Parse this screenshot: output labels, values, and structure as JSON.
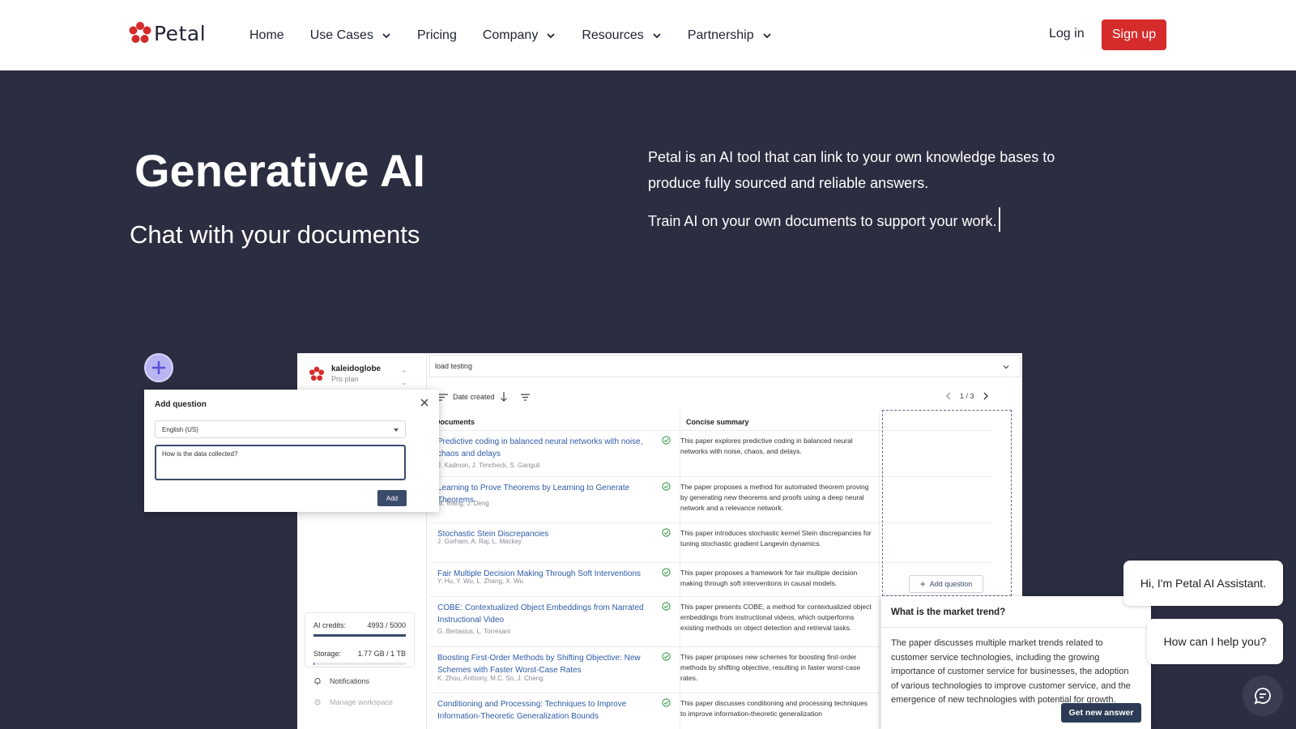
{
  "brand": {
    "name": "Petal",
    "accent": "#d62b2b"
  },
  "nav": {
    "items": [
      {
        "label": "Home",
        "dropdown": false
      },
      {
        "label": "Use Cases",
        "dropdown": true
      },
      {
        "label": "Pricing",
        "dropdown": false
      },
      {
        "label": "Company",
        "dropdown": true
      },
      {
        "label": "Resources",
        "dropdown": true
      },
      {
        "label": "Partnership",
        "dropdown": true
      }
    ],
    "login": "Log in",
    "signup": "Sign up"
  },
  "hero": {
    "title": "Generative AI",
    "subtitle": "Chat with your documents",
    "description": "Petal is an AI tool that can link to your own knowledge bases to produce fully sourced and reliable answers.",
    "description2": "Train AI on your own documents to support your work."
  },
  "app": {
    "workspace": {
      "name": "kaleidoglobe",
      "plan": "Pro plan"
    },
    "search_value": "load testing",
    "sort_label": "Date created",
    "pager": "1 / 3",
    "columns": {
      "documents": "Documents",
      "summary": "Concise summary"
    },
    "rows": [
      {
        "title": "Predictive coding in balanced neural networks with noise, chaos and delays",
        "authors": "J. Kadmon, J. Timcheck, S. Ganguli",
        "summary": "This paper explores predictive coding in balanced neural networks with noise, chaos, and delays."
      },
      {
        "title": "Learning to Prove Theorems by Learning to Generate Theorems",
        "authors": "M. Wang, J. Deng",
        "summary": "The paper proposes a method for automated theorem proving by generating new theorems and proofs using a deep neural network and a relevance network."
      },
      {
        "title": "Stochastic Stein Discrepancies",
        "authors": "J. Gorham, A. Raj, L. Mackey",
        "summary": "This paper introduces stochastic kernel Stein discrepancies for tuning stochastic gradient Langevin dynamics."
      },
      {
        "title": "Fair Multiple Decision Making Through Soft Interventions",
        "authors": "Y. Hu, Y. Wu, L. Zhang, X. Wu",
        "summary": "This paper proposes a framework for fair multiple decision making through soft interventions in causal models."
      },
      {
        "title": "COBE: Contextualized Object Embeddings from Narrated Instructional Video",
        "authors": "G. Bertasius, L. Torresani",
        "summary": "This paper presents COBE, a method for contextualized object embeddings from instructional videos, which outperforms existing methods on object detection and retrieval tasks."
      },
      {
        "title": "Boosting First-Order Methods by Shifting Objective: New Schemes with Faster Worst-Case Rates",
        "authors": "K. Zhou, Anthony, M.C. So, J. Cheng",
        "summary": "This paper proposes new schemes for boosting first-order methods by shifting objective, resulting in faster worst-case rates."
      },
      {
        "title": "Conditioning and Processing: Techniques to Improve Information-Theoretic Generalization Bounds",
        "authors": "",
        "summary": "This paper discusses conditioning and processing techniques to improve information-theoretic generalization"
      }
    ],
    "add_question_btn": "Add question",
    "credits": {
      "label": "AI credits:",
      "value": "4993 / 5000",
      "fraction": 0.9986
    },
    "storage": {
      "label": "Storage:",
      "value": "1.77 GB / 1 TB",
      "fraction": 0.0018
    },
    "side_links": {
      "notifications": "Notifications",
      "manage": "Manage workspace"
    }
  },
  "modal": {
    "title": "Add question",
    "language": "English (US)",
    "question": "How is the data collected?",
    "add": "Add"
  },
  "trend": {
    "question": "What is the market trend?",
    "answer": "The paper discusses multiple market trends related to customer service technologies, including the growing importance of customer service for businesses, the adoption of various technologies to improve customer service, and the emergence of new technologies with potential for growth.",
    "button": "Get new answer"
  },
  "chat": {
    "greeting": "Hi, I'm Petal AI Assistant.",
    "prompt": "How can I help you?"
  }
}
